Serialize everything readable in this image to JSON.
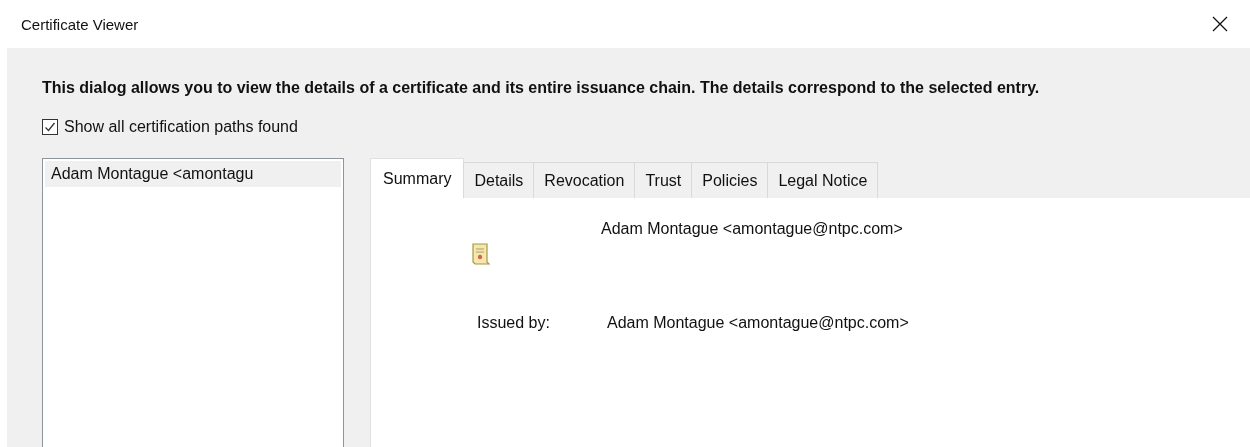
{
  "window": {
    "title": "Certificate Viewer"
  },
  "description": "This dialog allows you to view the details of a certificate and its entire issuance chain. The details correspond to the selected entry.",
  "show_all_paths": {
    "label": "Show all certification paths found",
    "checked": true
  },
  "chain": [
    {
      "label": "Adam Montague <amontagu",
      "selected": true
    }
  ],
  "tabs": [
    {
      "label": "Summary",
      "selected": true
    },
    {
      "label": "Details",
      "selected": false
    },
    {
      "label": "Revocation",
      "selected": false
    },
    {
      "label": "Trust",
      "selected": false
    },
    {
      "label": "Policies",
      "selected": false
    },
    {
      "label": "Legal Notice",
      "selected": false
    }
  ],
  "summary": {
    "subject": "Adam Montague <amontague@ntpc.com>",
    "fields": [
      {
        "label": "Issued by:",
        "value": "Adam Montague <amontague@ntpc.com>"
      }
    ]
  }
}
